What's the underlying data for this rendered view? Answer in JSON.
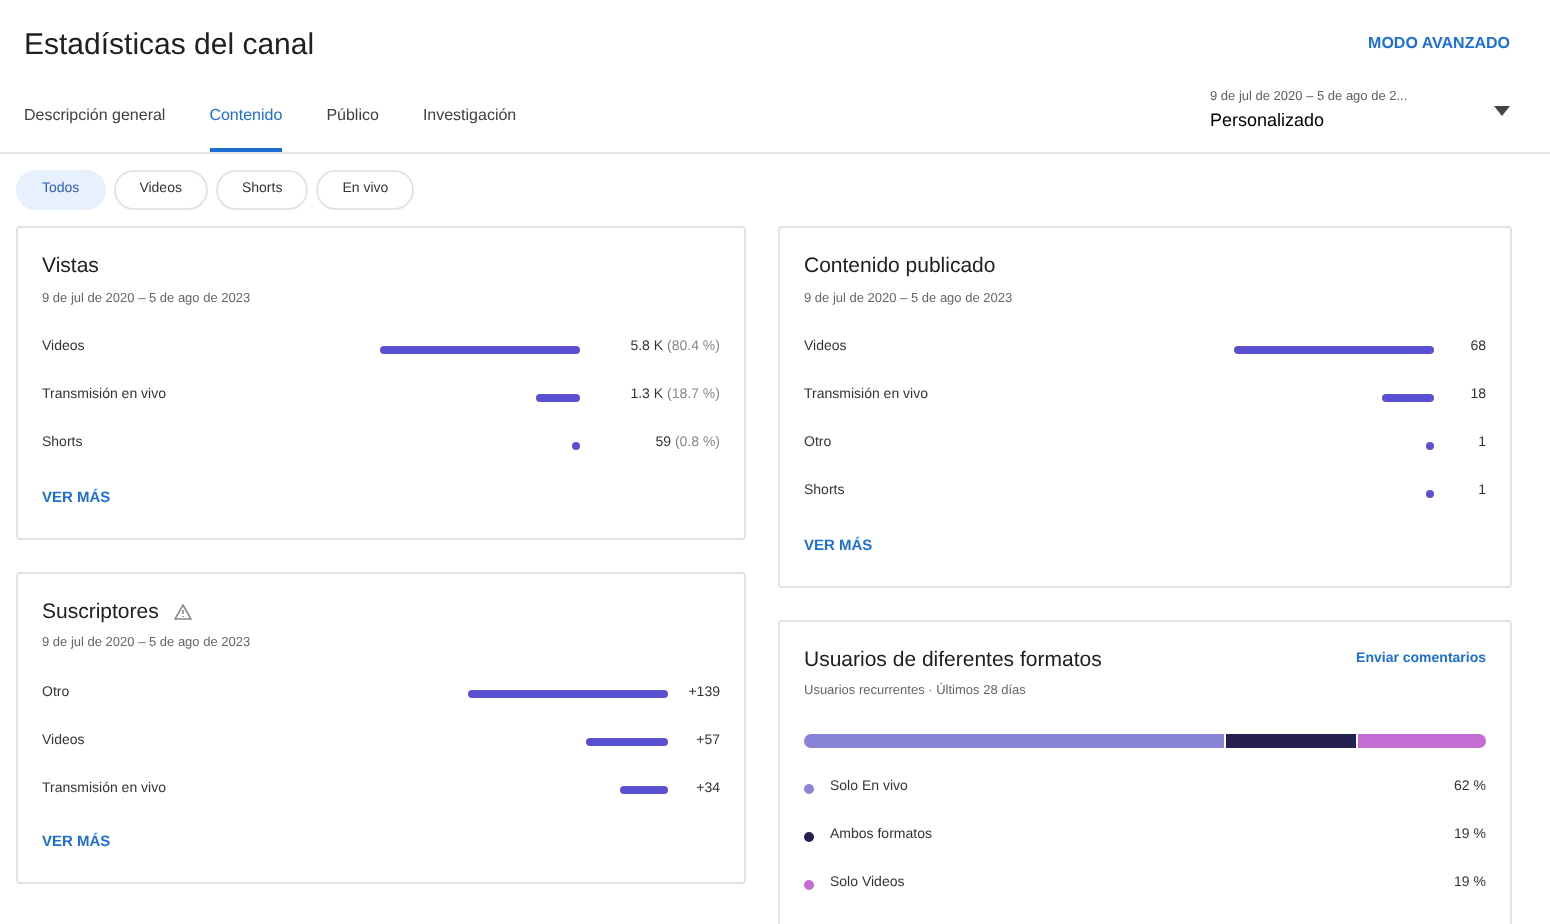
{
  "title": "Estadísticas del canal",
  "advanced_button": "MODO AVANZADO",
  "tabs": [
    {
      "label": "Descripción general",
      "selected": false
    },
    {
      "label": "Contenido",
      "selected": true
    },
    {
      "label": "Público",
      "selected": false
    },
    {
      "label": "Investigación",
      "selected": false
    }
  ],
  "date_picker": {
    "range": "9 de jul de 2020 – 5 de ago de 2...",
    "value": "Personalizado"
  },
  "chips": [
    {
      "label": "Todos",
      "selected": true
    },
    {
      "label": "Videos",
      "selected": false
    },
    {
      "label": "Shorts",
      "selected": false
    },
    {
      "label": "En vivo",
      "selected": false
    }
  ],
  "cards": [
    {
      "title": "Vistas",
      "warning": false,
      "subtitle": "9 de jul de 2020 – 5 de ago de 2023",
      "rows": [
        {
          "label": "Videos",
          "value": "5.8 K",
          "share": "(80.4 %)"
        },
        {
          "label": "Transmisión en vivo",
          "value": "1.3 K",
          "share": "(18.7 %)"
        },
        {
          "label": "Shorts",
          "value": "59",
          "share": "(0.8 %)"
        }
      ],
      "link": "VER MÁS"
    },
    {
      "title": "Suscriptores",
      "warning": true,
      "subtitle": "9 de jul de 2020 – 5 de ago de 2023",
      "rows": [
        {
          "label": "Otro",
          "value": "+139"
        },
        {
          "label": "Videos",
          "value": "+57"
        },
        {
          "label": "Transmisión en vivo",
          "value": "+34"
        }
      ],
      "link": "VER MÁS"
    },
    {
      "title": "Contenido publicado",
      "warning": false,
      "subtitle": "9 de jul de 2020 – 5 de ago de 2023",
      "rows": [
        {
          "label": "Videos",
          "value": "68"
        },
        {
          "label": "Transmisión en vivo",
          "value": "18"
        },
        {
          "label": "Otro",
          "value": "1"
        },
        {
          "label": "Shorts",
          "value": "1"
        }
      ],
      "link": "VER MÁS"
    }
  ],
  "formats_card": {
    "title": "Usuarios de diferentes formatos",
    "feedback_link": "Enviar comentarios",
    "subtitle": "Usuarios recurrentes · Últimos 28 días",
    "segments": [
      {
        "label": "Solo En vivo",
        "value": "62 %",
        "color": "#8a84d9"
      },
      {
        "label": "Ambos formatos",
        "value": "19 %",
        "color": "#25204f"
      },
      {
        "label": "Solo Videos",
        "value": "19 %",
        "color": "#c36cd3"
      }
    ]
  }
}
